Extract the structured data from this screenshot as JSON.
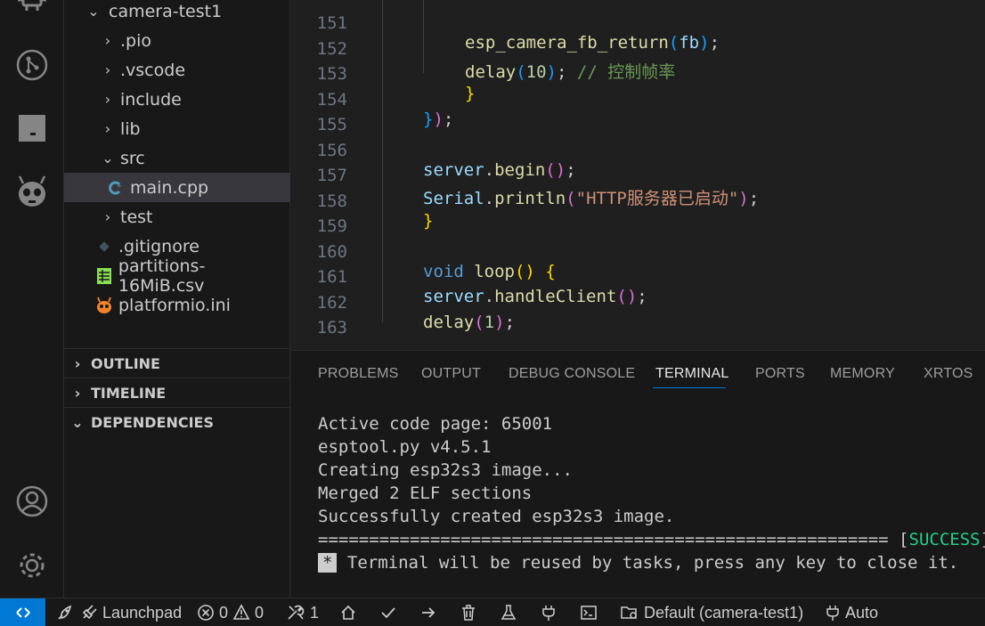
{
  "activity_bar": {
    "icons": [
      "chip-icon",
      "source-control-icon",
      "panel-icon",
      "platformio-alien-icon",
      "account-icon",
      "settings-gear-icon"
    ]
  },
  "explorer": {
    "project": "camera-test1",
    "items": [
      {
        "label": ".pio",
        "type": "folder",
        "expanded": false
      },
      {
        "label": ".vscode",
        "type": "folder",
        "expanded": false
      },
      {
        "label": "include",
        "type": "folder",
        "expanded": false
      },
      {
        "label": "lib",
        "type": "folder",
        "expanded": false
      },
      {
        "label": "src",
        "type": "folder",
        "expanded": true
      },
      {
        "label": "main.cpp",
        "type": "file",
        "selected": true
      },
      {
        "label": "test",
        "type": "folder",
        "expanded": false
      },
      {
        "label": ".gitignore",
        "type": "file"
      },
      {
        "label": "partitions-16MiB.csv",
        "type": "file"
      },
      {
        "label": "platformio.ini",
        "type": "file"
      }
    ],
    "sections": [
      "OUTLINE",
      "TIMELINE",
      "DEPENDENCIES"
    ]
  },
  "editor": {
    "line_numbers": [
      "151",
      "152",
      "153",
      "154",
      "155",
      "156",
      "157",
      "158",
      "159",
      "160",
      "161",
      "162",
      "163"
    ],
    "tokens": {
      "l151_func": "esp_camera_fb_return",
      "l151_arg": "fb",
      "l152_func": "delay",
      "l152_num": "10",
      "l152_comment": "// 控制帧率",
      "l156_obj": "server",
      "l156_method": "begin",
      "l157_obj": "Serial",
      "l157_method": "println",
      "l157_str": "\"HTTP服务器已启动\"",
      "l160_kw": "void",
      "l160_func": "loop",
      "l161_obj": "server",
      "l161_method": "handleClient",
      "l162_func": "delay",
      "l162_num": "1"
    }
  },
  "panel": {
    "tabs": [
      "PROBLEMS",
      "OUTPUT",
      "DEBUG CONSOLE",
      "TERMINAL",
      "PORTS",
      "MEMORY",
      "XRTOS"
    ],
    "active_tab": "TERMINAL",
    "terminal": {
      "lines": [
        "Active code page: 65001",
        "esptool.py v4.5.1",
        "Creating esp32s3 image...",
        "Merged 2 ELF sections",
        "Successfully created esp32s3 image."
      ],
      "separator": "========================================================",
      "success_open": "[",
      "success_word": "SUCCESS",
      "success_close": "]",
      "star": "*",
      "reuse_message": "Terminal will be reused by tasks, press any key to close it."
    }
  },
  "statusbar": {
    "launchpad": "Launchpad",
    "errors": "0",
    "warnings": "0",
    "tools_count": "1",
    "env": "Default (camera-test1)",
    "port": "Auto"
  },
  "colors": {
    "accent": "#0078d4",
    "success": "#23d18b"
  }
}
